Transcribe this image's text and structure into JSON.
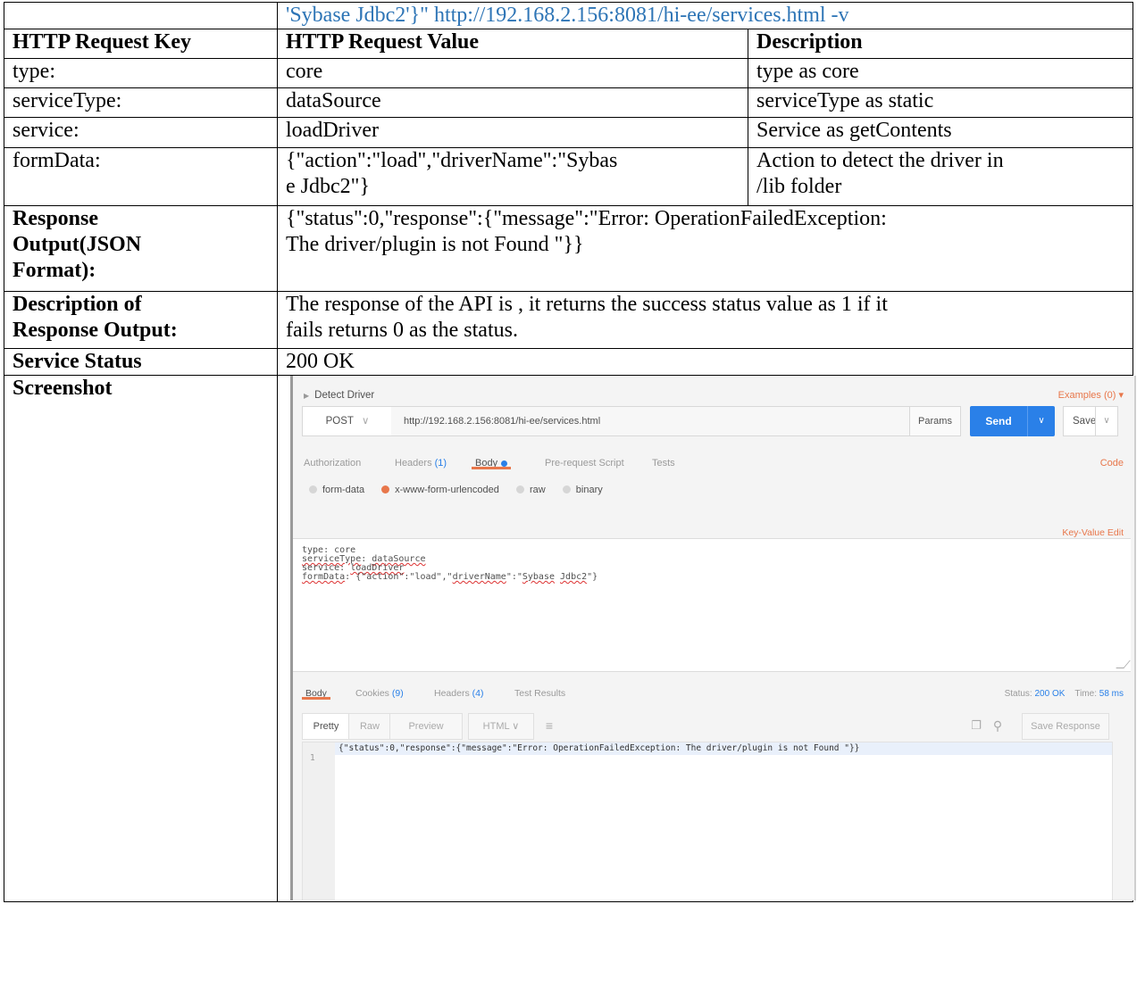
{
  "table": {
    "top_cell": "'Sybase Jdbc2'}\" http://192.168.2.156:8081/hi-ee/services.html -v",
    "headers": [
      "HTTP Request Key",
      "HTTP Request Value",
      "Description"
    ],
    "rows": [
      {
        "key": "type:",
        "value": "core",
        "desc": "type as core"
      },
      {
        "key": "serviceType:",
        "value": "dataSource",
        "desc": "serviceType as static"
      },
      {
        "key": "service:",
        "value": "loadDriver",
        "desc": "Service as getContents"
      },
      {
        "key": "formData:",
        "value_line1": "{\"action\":\"load\",\"driverName\":\"Sybas",
        "value_line2": "e Jdbc2\"}",
        "desc_line1": "Action to detect the driver in",
        "desc_line2": "/lib folder"
      }
    ],
    "response_output": {
      "label_line1": "Response",
      "label_line2": "Output(JSON",
      "label_line3": "Format):",
      "value_line1": "{\"status\":0,\"response\":{\"message\":\"Error: OperationFailedException:",
      "value_line2": "The driver/plugin is not Found \"}}"
    },
    "description_of_response": {
      "label_line1": "Description of",
      "label_line2": "Response Output:",
      "value_line1": "The response of the API is , it returns the success status value as 1 if it",
      "value_line2": "fails returns 0 as the status."
    },
    "service_status": {
      "label": "Service Status",
      "value": "200 OK"
    },
    "screenshot_label": "Screenshot"
  },
  "postman": {
    "request_name": "Detect Driver",
    "examples": "Examples (0) ▾",
    "method": "POST",
    "url": "http://192.168.2.156:8081/hi-ee/services.html",
    "params": "Params",
    "send": "Send",
    "save": "Save",
    "tabs": {
      "authorization": "Authorization",
      "headers": "Headers",
      "headers_count": "(1)",
      "body": "Body",
      "prerequest": "Pre-request Script",
      "tests": "Tests",
      "code": "Code"
    },
    "body_modes": [
      "form-data",
      "x-www-form-urlencoded",
      "raw",
      "binary"
    ],
    "key_value_edit": "Key-Value Edit",
    "editor_lines": {
      "l1": "type: core",
      "l2a": "serviceType",
      "l2b": ": ",
      "l2c": "dataSource",
      "l3a": "service: ",
      "l3b": "loadDriver",
      "l4a": "formData",
      "l4b": ": {\"action\":\"load\",\"",
      "l4c": "driverName",
      "l4d": "\":\"",
      "l4e": "Sybase",
      "l4f": " ",
      "l4g": "Jdbc2",
      "l4h": "\"}"
    },
    "response_tabs": {
      "body": "Body",
      "cookies": "Cookies",
      "cookies_count": "(9)",
      "headers": "Headers",
      "headers_count": "(4)",
      "test_results": "Test Results"
    },
    "status_label": "Status:",
    "status_value": "200 OK",
    "time_label": "Time:",
    "time_value": "58 ms",
    "view_buttons": {
      "pretty": "Pretty",
      "raw": "Raw",
      "preview": "Preview",
      "format": "HTML ∨"
    },
    "save_response": "Save Response",
    "result_line_no": "1",
    "result_line": "{\"status\":0,\"response\":{\"message\":\"Error: OperationFailedException: The driver/plugin is not Found \"}}"
  }
}
